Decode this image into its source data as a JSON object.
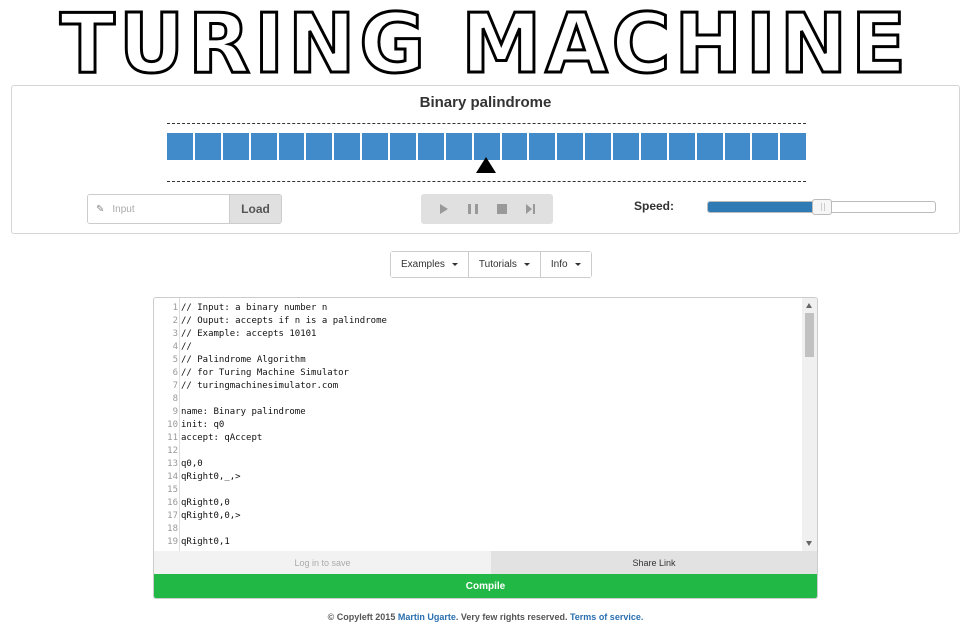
{
  "logo": {
    "text": "TURING MACHINE"
  },
  "simulator": {
    "title": "Binary palindrome",
    "tape": {
      "cell_count": 23,
      "cell_color": "#428bca"
    },
    "input": {
      "placeholder": "Input",
      "value": ""
    },
    "load_label": "Load",
    "controls": [
      "play-icon",
      "pause-icon",
      "stop-icon",
      "step-icon"
    ],
    "speed": {
      "label": "Speed:",
      "value": 0.5
    }
  },
  "menu": {
    "items": [
      {
        "label": "Examples"
      },
      {
        "label": "Tutorials"
      },
      {
        "label": "Info"
      }
    ]
  },
  "editor": {
    "lines": [
      "// Input: a binary number n",
      "// Ouput: accepts if n is a palindrome",
      "// Example: accepts 10101",
      "//",
      "// Palindrome Algorithm",
      "// for Turing Machine Simulator",
      "// turingmachinesimulator.com",
      "",
      "name: Binary palindrome",
      "init: q0",
      "accept: qAccept",
      "",
      "q0,0",
      "qRight0,_,>",
      "",
      "qRight0,0",
      "qRight0,0,>",
      "",
      "qRight0,1"
    ],
    "login_to_save": "Log in to save",
    "share_link": "Share Link",
    "compile": "Compile"
  },
  "footer": {
    "copyleft": "Copyleft 2015",
    "author": "Martin Ugarte",
    "rights": "Very few rights reserved.",
    "terms": "Terms of service."
  },
  "colors": {
    "accent": "#428bca",
    "compile": "#22b845",
    "speed_fill": "#2d7ab5",
    "link": "#2a6fb0"
  }
}
